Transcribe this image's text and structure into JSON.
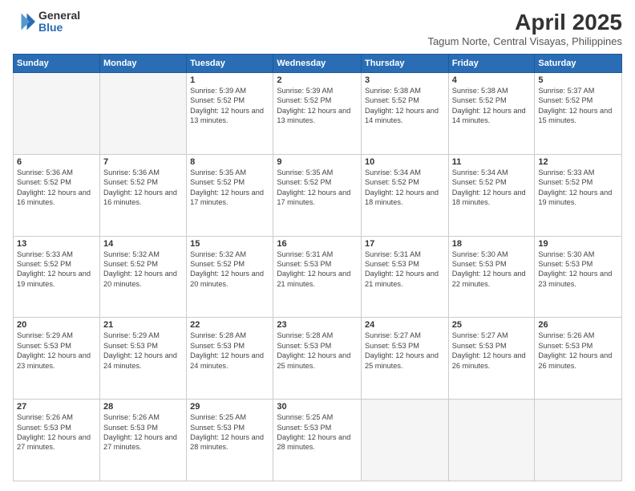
{
  "logo": {
    "general": "General",
    "blue": "Blue"
  },
  "title": {
    "month": "April 2025",
    "location": "Tagum Norte, Central Visayas, Philippines"
  },
  "headers": [
    "Sunday",
    "Monday",
    "Tuesday",
    "Wednesday",
    "Thursday",
    "Friday",
    "Saturday"
  ],
  "weeks": [
    [
      {
        "day": "",
        "sunrise": "",
        "sunset": "",
        "daylight": ""
      },
      {
        "day": "",
        "sunrise": "",
        "sunset": "",
        "daylight": ""
      },
      {
        "day": "1",
        "sunrise": "Sunrise: 5:39 AM",
        "sunset": "Sunset: 5:52 PM",
        "daylight": "Daylight: 12 hours and 13 minutes."
      },
      {
        "day": "2",
        "sunrise": "Sunrise: 5:39 AM",
        "sunset": "Sunset: 5:52 PM",
        "daylight": "Daylight: 12 hours and 13 minutes."
      },
      {
        "day": "3",
        "sunrise": "Sunrise: 5:38 AM",
        "sunset": "Sunset: 5:52 PM",
        "daylight": "Daylight: 12 hours and 14 minutes."
      },
      {
        "day": "4",
        "sunrise": "Sunrise: 5:38 AM",
        "sunset": "Sunset: 5:52 PM",
        "daylight": "Daylight: 12 hours and 14 minutes."
      },
      {
        "day": "5",
        "sunrise": "Sunrise: 5:37 AM",
        "sunset": "Sunset: 5:52 PM",
        "daylight": "Daylight: 12 hours and 15 minutes."
      }
    ],
    [
      {
        "day": "6",
        "sunrise": "Sunrise: 5:36 AM",
        "sunset": "Sunset: 5:52 PM",
        "daylight": "Daylight: 12 hours and 16 minutes."
      },
      {
        "day": "7",
        "sunrise": "Sunrise: 5:36 AM",
        "sunset": "Sunset: 5:52 PM",
        "daylight": "Daylight: 12 hours and 16 minutes."
      },
      {
        "day": "8",
        "sunrise": "Sunrise: 5:35 AM",
        "sunset": "Sunset: 5:52 PM",
        "daylight": "Daylight: 12 hours and 17 minutes."
      },
      {
        "day": "9",
        "sunrise": "Sunrise: 5:35 AM",
        "sunset": "Sunset: 5:52 PM",
        "daylight": "Daylight: 12 hours and 17 minutes."
      },
      {
        "day": "10",
        "sunrise": "Sunrise: 5:34 AM",
        "sunset": "Sunset: 5:52 PM",
        "daylight": "Daylight: 12 hours and 18 minutes."
      },
      {
        "day": "11",
        "sunrise": "Sunrise: 5:34 AM",
        "sunset": "Sunset: 5:52 PM",
        "daylight": "Daylight: 12 hours and 18 minutes."
      },
      {
        "day": "12",
        "sunrise": "Sunrise: 5:33 AM",
        "sunset": "Sunset: 5:52 PM",
        "daylight": "Daylight: 12 hours and 19 minutes."
      }
    ],
    [
      {
        "day": "13",
        "sunrise": "Sunrise: 5:33 AM",
        "sunset": "Sunset: 5:52 PM",
        "daylight": "Daylight: 12 hours and 19 minutes."
      },
      {
        "day": "14",
        "sunrise": "Sunrise: 5:32 AM",
        "sunset": "Sunset: 5:52 PM",
        "daylight": "Daylight: 12 hours and 20 minutes."
      },
      {
        "day": "15",
        "sunrise": "Sunrise: 5:32 AM",
        "sunset": "Sunset: 5:52 PM",
        "daylight": "Daylight: 12 hours and 20 minutes."
      },
      {
        "day": "16",
        "sunrise": "Sunrise: 5:31 AM",
        "sunset": "Sunset: 5:53 PM",
        "daylight": "Daylight: 12 hours and 21 minutes."
      },
      {
        "day": "17",
        "sunrise": "Sunrise: 5:31 AM",
        "sunset": "Sunset: 5:53 PM",
        "daylight": "Daylight: 12 hours and 21 minutes."
      },
      {
        "day": "18",
        "sunrise": "Sunrise: 5:30 AM",
        "sunset": "Sunset: 5:53 PM",
        "daylight": "Daylight: 12 hours and 22 minutes."
      },
      {
        "day": "19",
        "sunrise": "Sunrise: 5:30 AM",
        "sunset": "Sunset: 5:53 PM",
        "daylight": "Daylight: 12 hours and 23 minutes."
      }
    ],
    [
      {
        "day": "20",
        "sunrise": "Sunrise: 5:29 AM",
        "sunset": "Sunset: 5:53 PM",
        "daylight": "Daylight: 12 hours and 23 minutes."
      },
      {
        "day": "21",
        "sunrise": "Sunrise: 5:29 AM",
        "sunset": "Sunset: 5:53 PM",
        "daylight": "Daylight: 12 hours and 24 minutes."
      },
      {
        "day": "22",
        "sunrise": "Sunrise: 5:28 AM",
        "sunset": "Sunset: 5:53 PM",
        "daylight": "Daylight: 12 hours and 24 minutes."
      },
      {
        "day": "23",
        "sunrise": "Sunrise: 5:28 AM",
        "sunset": "Sunset: 5:53 PM",
        "daylight": "Daylight: 12 hours and 25 minutes."
      },
      {
        "day": "24",
        "sunrise": "Sunrise: 5:27 AM",
        "sunset": "Sunset: 5:53 PM",
        "daylight": "Daylight: 12 hours and 25 minutes."
      },
      {
        "day": "25",
        "sunrise": "Sunrise: 5:27 AM",
        "sunset": "Sunset: 5:53 PM",
        "daylight": "Daylight: 12 hours and 26 minutes."
      },
      {
        "day": "26",
        "sunrise": "Sunrise: 5:26 AM",
        "sunset": "Sunset: 5:53 PM",
        "daylight": "Daylight: 12 hours and 26 minutes."
      }
    ],
    [
      {
        "day": "27",
        "sunrise": "Sunrise: 5:26 AM",
        "sunset": "Sunset: 5:53 PM",
        "daylight": "Daylight: 12 hours and 27 minutes."
      },
      {
        "day": "28",
        "sunrise": "Sunrise: 5:26 AM",
        "sunset": "Sunset: 5:53 PM",
        "daylight": "Daylight: 12 hours and 27 minutes."
      },
      {
        "day": "29",
        "sunrise": "Sunrise: 5:25 AM",
        "sunset": "Sunset: 5:53 PM",
        "daylight": "Daylight: 12 hours and 28 minutes."
      },
      {
        "day": "30",
        "sunrise": "Sunrise: 5:25 AM",
        "sunset": "Sunset: 5:53 PM",
        "daylight": "Daylight: 12 hours and 28 minutes."
      },
      {
        "day": "",
        "sunrise": "",
        "sunset": "",
        "daylight": ""
      },
      {
        "day": "",
        "sunrise": "",
        "sunset": "",
        "daylight": ""
      },
      {
        "day": "",
        "sunrise": "",
        "sunset": "",
        "daylight": ""
      }
    ]
  ]
}
